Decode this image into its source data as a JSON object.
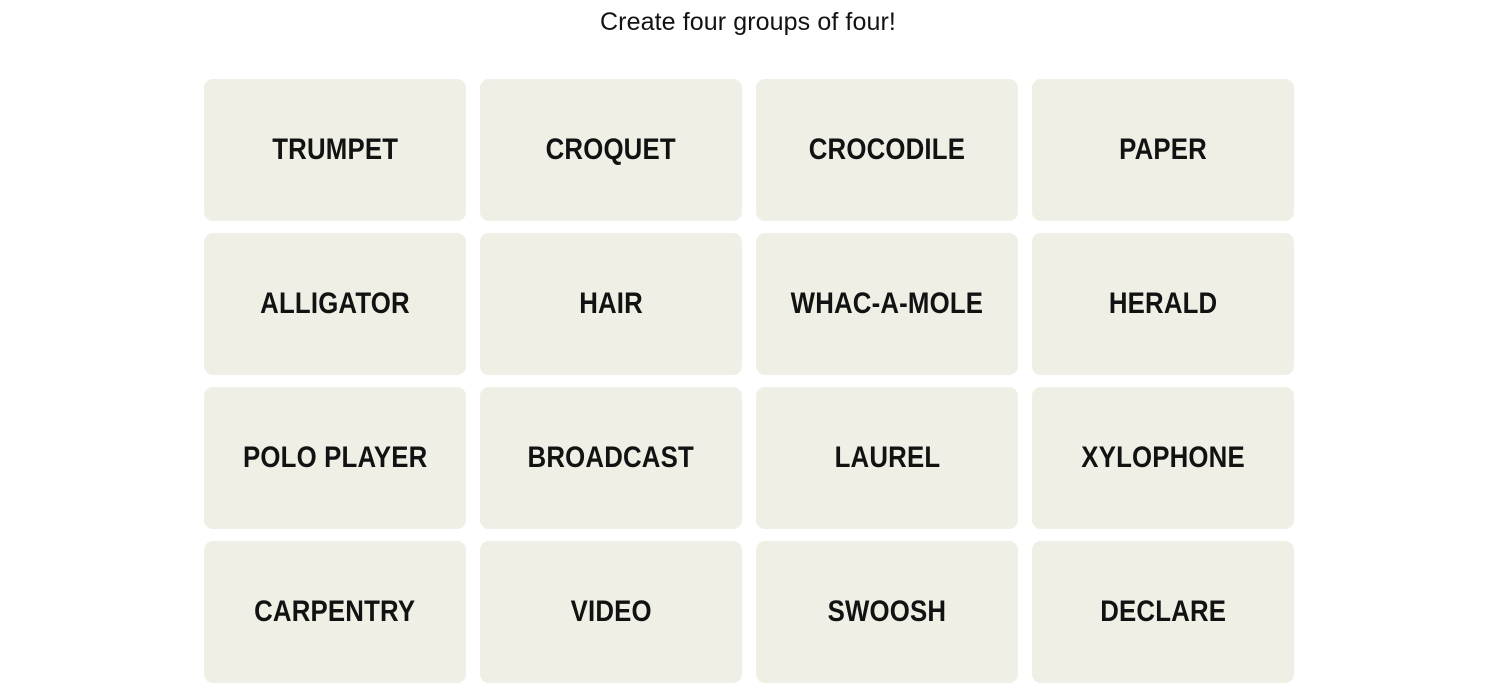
{
  "header": {
    "title": "Create four groups of four!"
  },
  "colors": {
    "page_background": "#ffffff",
    "tile_background": "#efefe6",
    "text": "#121212"
  },
  "board": {
    "rows": 4,
    "columns": 4,
    "tiles": [
      {
        "label": "TRUMPET"
      },
      {
        "label": "CROQUET"
      },
      {
        "label": "CROCODILE"
      },
      {
        "label": "PAPER"
      },
      {
        "label": "ALLIGATOR"
      },
      {
        "label": "HAIR"
      },
      {
        "label": "WHAC-A-MOLE"
      },
      {
        "label": "HERALD"
      },
      {
        "label": "POLO PLAYER"
      },
      {
        "label": "BROADCAST"
      },
      {
        "label": "LAUREL"
      },
      {
        "label": "XYLOPHONE"
      },
      {
        "label": "CARPENTRY"
      },
      {
        "label": "VIDEO"
      },
      {
        "label": "SWOOSH"
      },
      {
        "label": "DECLARE"
      }
    ]
  }
}
